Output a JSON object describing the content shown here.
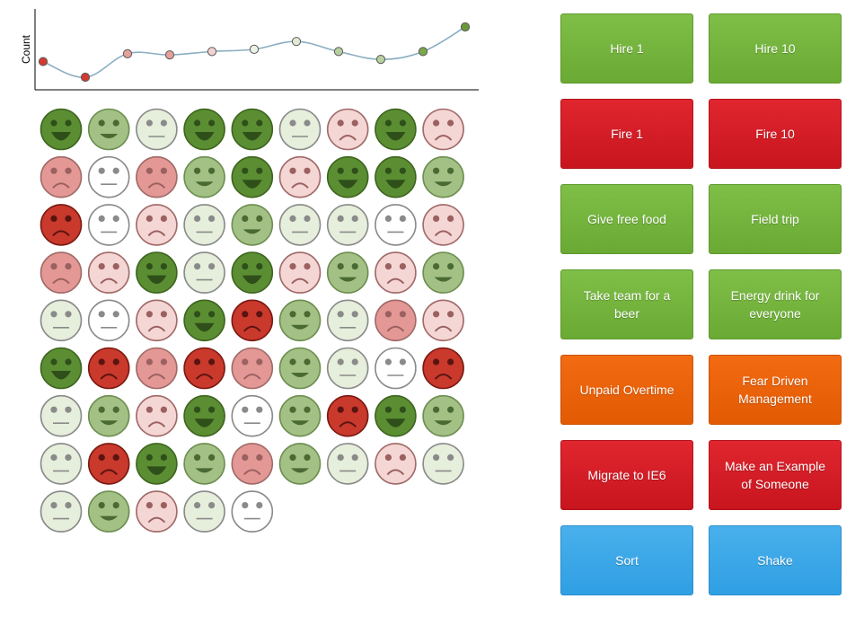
{
  "chart_data": {
    "type": "line",
    "ylabel": "Count",
    "xlabel": "",
    "values": [
      -1.0,
      -2.4,
      -0.3,
      -0.4,
      -0.1,
      0.1,
      0.8,
      -0.1,
      -0.8,
      -0.1,
      2.1
    ],
    "point_colors": [
      "#d23a30",
      "#d23a30",
      "#e6a09c",
      "#e6a09c",
      "#f2d2d0",
      "#eef2e6",
      "#dfe9d3",
      "#b8cf9d",
      "#b8cf9d",
      "#7aa84a",
      "#6a9a38"
    ],
    "line_color": "#8aaec2",
    "grid": false
  },
  "faces": {
    "moods": [
      2,
      1,
      0,
      2,
      2,
      0,
      -1,
      2,
      -1,
      -1,
      0,
      -1,
      1,
      2,
      -1,
      2,
      2,
      1,
      -2,
      0,
      -1,
      0,
      1,
      0,
      0,
      0,
      -1,
      -1,
      -1,
      2,
      0,
      2,
      -1,
      1,
      -1,
      1,
      0,
      0,
      -1,
      2,
      -2,
      1,
      0,
      -1,
      -1,
      2,
      -2,
      -1,
      -2,
      -1,
      1,
      0,
      0,
      -2,
      0,
      1,
      -1,
      2,
      0,
      1,
      -2,
      2,
      1,
      0,
      -2,
      2,
      1,
      -1,
      1,
      0,
      -1,
      0,
      0,
      1,
      -1,
      0,
      0
    ]
  },
  "colors": {
    "happy": "#5b8e32",
    "content": "#a3c184",
    "neutral": "#e6eedc",
    "blank": "#ffffff",
    "unhappy": "#e39895",
    "sad_light": "#f4d6d4",
    "angry": "#c9392c"
  },
  "buttons": {
    "hire_1": "Hire 1",
    "hire_10": "Hire 10",
    "fire_1": "Fire 1",
    "fire_10": "Fire 10",
    "free_food": "Give free food",
    "field_trip": "Field trip",
    "beer_line1": "Take team for a",
    "beer_line2": "beer",
    "energy_line1": "Energy drink for",
    "energy_line2": "everyone",
    "unpaid_overtime": "Unpaid Overtime",
    "fear_line1": "Fear Driven",
    "fear_line2": "Management",
    "migrate_ie6": "Migrate to IE6",
    "example_line1": "Make an Example",
    "example_line2": "of Someone",
    "sort": "Sort",
    "shake": "Shake"
  }
}
